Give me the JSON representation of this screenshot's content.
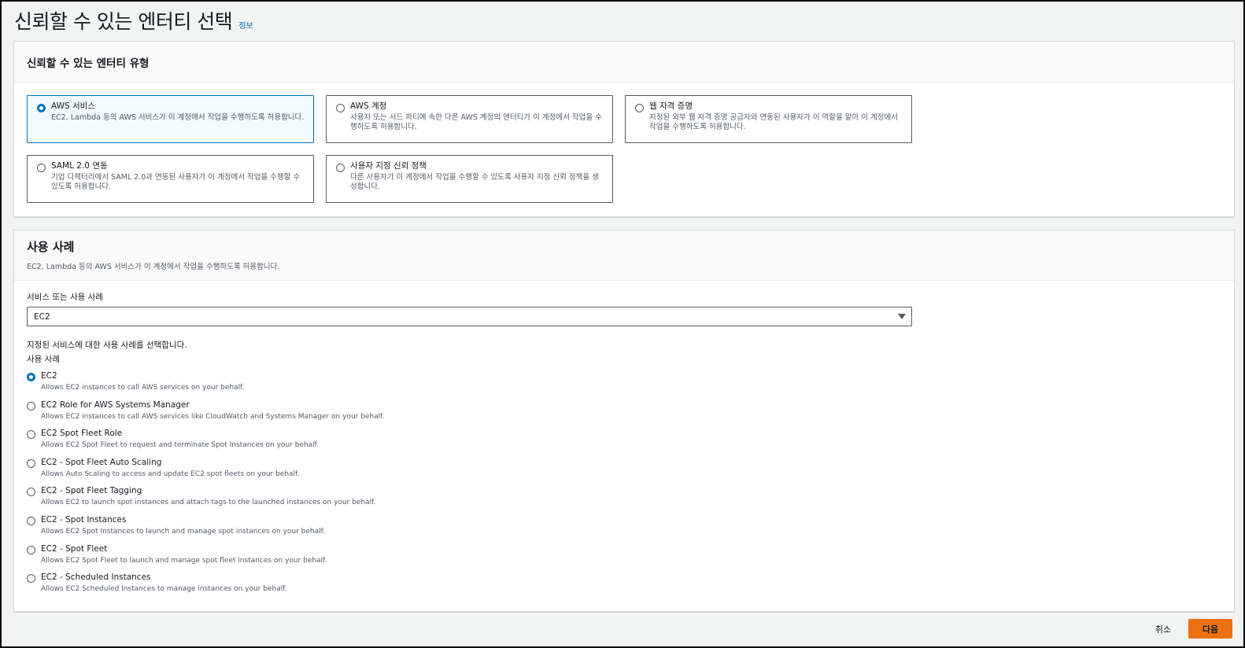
{
  "header": {
    "title": "신뢰할 수 있는 엔터티 선택",
    "info_link": "정보"
  },
  "entity_type": {
    "title": "신뢰할 수 있는 엔터티 유형",
    "options": [
      {
        "title": "AWS 서비스",
        "desc": "EC2, Lambda 등의 AWS 서비스가 이 계정에서 작업을 수행하도록 허용합니다.",
        "selected": true
      },
      {
        "title": "AWS 계정",
        "desc": "사용자 또는 서드 파티에 속한 다른 AWS 계정의 엔터티가 이 계정에서 작업을 수행하도록 허용합니다.",
        "selected": false
      },
      {
        "title": "웹 자격 증명",
        "desc": "지정된 외부 웹 자격 증명 공급자와 연동된 사용자가 이 역할을 맡아 이 계정에서 작업을 수행하도록 허용합니다.",
        "selected": false
      },
      {
        "title": "SAML 2.0 연동",
        "desc": "기업 디렉터리에서 SAML 2.0과 연동된 사용자가 이 계정에서 작업을 수행할 수 있도록 허용합니다.",
        "selected": false
      },
      {
        "title": "사용자 지정 신뢰 정책",
        "desc": "다른 사용자가 이 계정에서 작업을 수행할 수 있도록 사용자 지정 신뢰 정책을 생성합니다.",
        "selected": false
      }
    ]
  },
  "use_case": {
    "title": "사용 사례",
    "desc": "EC2, Lambda 등의 AWS 서비스가 이 계정에서 작업을 수행하도록 허용합니다.",
    "service_label": "서비스 또는 사용 사례",
    "service_value": "EC2",
    "select_hint": "지정된 서비스에 대한 사용 사례를 선택합니다.",
    "list_label": "사용 사례",
    "items": [
      {
        "title": "EC2",
        "desc": "Allows EC2 instances to call AWS services on your behalf.",
        "selected": true
      },
      {
        "title": "EC2 Role for AWS Systems Manager",
        "desc": "Allows EC2 instances to call AWS services like CloudWatch and Systems Manager on your behalf.",
        "selected": false
      },
      {
        "title": "EC2 Spot Fleet Role",
        "desc": "Allows EC2 Spot Fleet to request and terminate Spot Instances on your behalf.",
        "selected": false
      },
      {
        "title": "EC2 - Spot Fleet Auto Scaling",
        "desc": "Allows Auto Scaling to access and update EC2 spot fleets on your behalf.",
        "selected": false
      },
      {
        "title": "EC2 - Spot Fleet Tagging",
        "desc": "Allows EC2 to launch spot instances and attach tags to the launched instances on your behalf.",
        "selected": false
      },
      {
        "title": "EC2 - Spot Instances",
        "desc": "Allows EC2 Spot Instances to launch and manage spot instances on your behalf.",
        "selected": false
      },
      {
        "title": "EC2 - Spot Fleet",
        "desc": "Allows EC2 Spot Fleet to launch and manage spot fleet instances on your behalf.",
        "selected": false
      },
      {
        "title": "EC2 - Scheduled Instances",
        "desc": "Allows EC2 Scheduled Instances to manage instances on your behalf.",
        "selected": false
      }
    ]
  },
  "footer": {
    "cancel_label": "취소",
    "next_label": "다음"
  },
  "colors": {
    "accent": "#0073bb",
    "primary_button": "#ec7211"
  }
}
